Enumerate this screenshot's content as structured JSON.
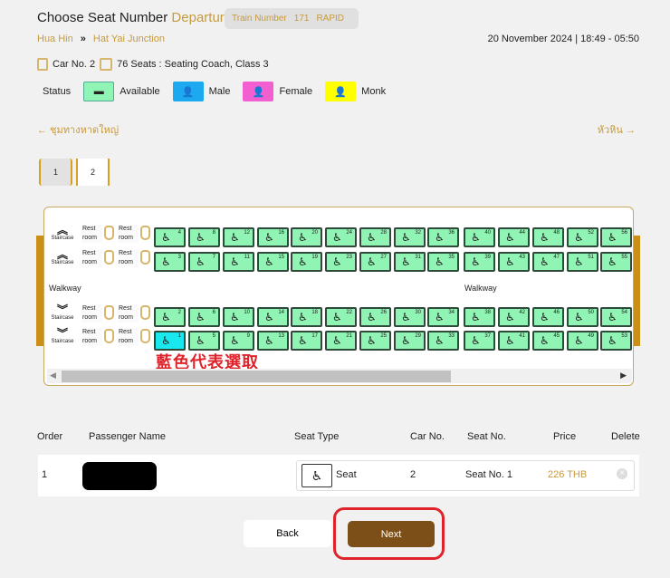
{
  "header": {
    "title": "Choose Seat Number",
    "direction": "Departure",
    "train_label": "Train Number",
    "train_number": "171",
    "train_type": "RAPID"
  },
  "route": {
    "from": "Hua Hin",
    "separator": "»",
    "to": "Hat Yai Junction",
    "datetime": "20 November 2024 | 18:49 - 05:50"
  },
  "car": {
    "car_label": "Car No. 2",
    "seats_label": "76 Seats : Seating Coach, Class 3"
  },
  "status": {
    "label": "Status",
    "items": [
      {
        "label": "Available",
        "color": "#90f5b4"
      },
      {
        "label": "Male",
        "color": "#1ca9ef"
      },
      {
        "label": "Female",
        "color": "#f25fd1"
      },
      {
        "label": "Monk",
        "color": "#ffff00"
      }
    ]
  },
  "nav": {
    "prev": "← ชุมทางหาดใหญ่",
    "next": "หัวหิน →"
  },
  "pages": [
    "1",
    "2"
  ],
  "map": {
    "staircase": "Staircase",
    "restroom": "Rest room",
    "walkway": "Walkway",
    "selected_seat": 1,
    "seat_rows": [
      [
        4,
        8,
        12,
        16,
        20,
        24,
        28,
        32,
        36,
        40,
        44,
        48,
        52,
        56
      ],
      [
        3,
        7,
        11,
        15,
        19,
        23,
        27,
        31,
        35,
        39,
        43,
        47,
        51,
        55
      ],
      [
        2,
        6,
        10,
        14,
        18,
        22,
        26,
        30,
        34,
        38,
        42,
        46,
        50,
        54
      ],
      [
        1,
        5,
        9,
        13,
        17,
        21,
        25,
        29,
        33,
        37,
        41,
        45,
        49,
        53
      ]
    ]
  },
  "annotation": "藍色代表選取",
  "table": {
    "headers": [
      "Order",
      "Passenger Name",
      "Seat Type",
      "Car No.",
      "Seat No.",
      "Price",
      "Delete"
    ],
    "row": {
      "order": "1",
      "seat_type": "Seat",
      "car": "2",
      "seat": "Seat No. 1",
      "price": "226 THB"
    }
  },
  "buttons": {
    "back": "Back",
    "next": "Next"
  }
}
